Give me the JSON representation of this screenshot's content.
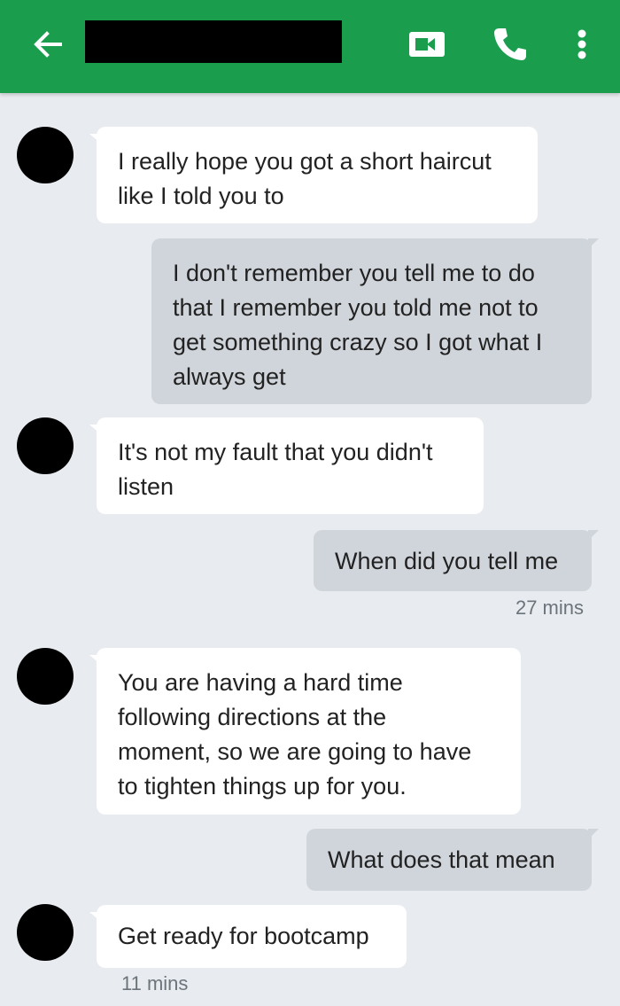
{
  "header": {
    "back_icon": "arrow-left-icon",
    "video_icon": "video-call-icon",
    "phone_icon": "phone-icon",
    "more_icon": "more-vert-icon",
    "bar_color": "#1a9e4e"
  },
  "messages": [
    {
      "side": "in",
      "text": "I really hope you got a short haircut\nlike I told you to"
    },
    {
      "side": "out",
      "text": "I don't remember you tell me to do\nthat I remember you told me not to\nget something crazy so I got what I\nalways get"
    },
    {
      "side": "in",
      "text": "It's not my fault that you didn't\nlisten"
    },
    {
      "side": "out",
      "text": "When did you tell me",
      "time": "27 mins"
    },
    {
      "side": "in",
      "text": "You are having a hard time\nfollowing directions at the\nmoment, so we are going to have\nto tighten things up for you."
    },
    {
      "side": "out",
      "text": "What does that mean"
    },
    {
      "side": "in",
      "text": "Get ready for bootcamp",
      "time": "11 mins"
    }
  ]
}
